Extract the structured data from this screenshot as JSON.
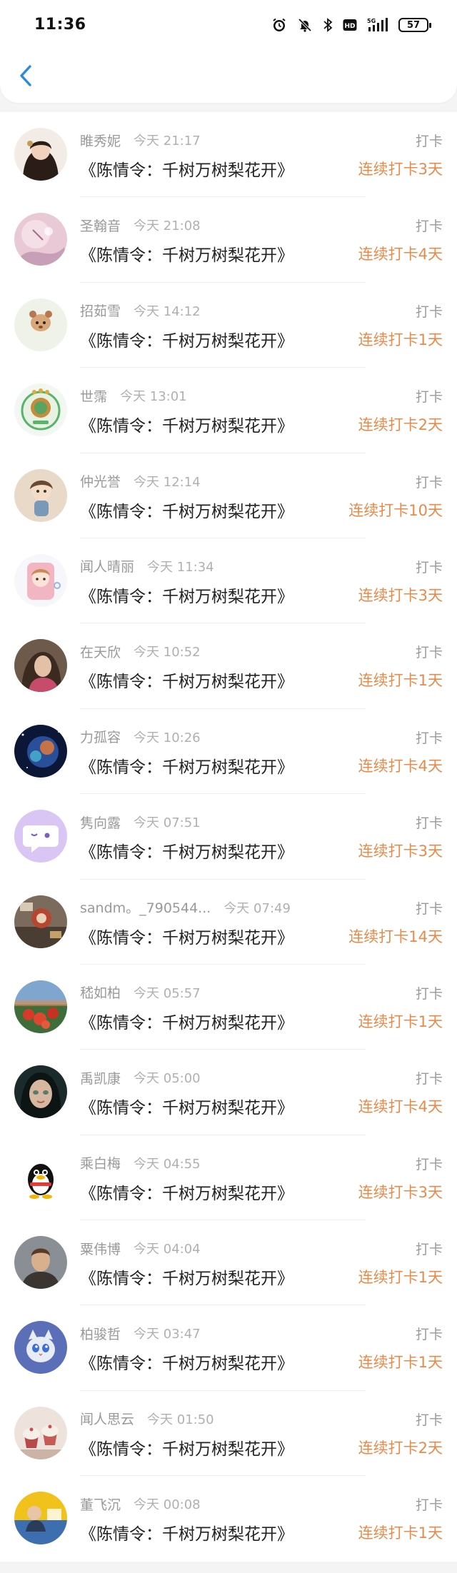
{
  "status_bar": {
    "time": "11:36",
    "battery": "57",
    "icons": [
      "alarm-icon",
      "mute-icon",
      "bluetooth-icon",
      "hd-icon",
      "signal-5g-icon",
      "battery-icon"
    ]
  },
  "header": {
    "back_icon": "chevron-left-icon",
    "accent_color": "#2a8bd8"
  },
  "colors": {
    "streak": "#e88a4a",
    "name": "#999999",
    "book": "#222222"
  },
  "checkins": [
    {
      "name": "睢秀妮",
      "time": "今天 21:17",
      "action": "打卡",
      "book": "《陈情令：千树万树梨花开》",
      "streak": "连续打卡3天",
      "avatar": "avatar-girl-dark-hair"
    },
    {
      "name": "圣翰音",
      "time": "今天 21:08",
      "action": "打卡",
      "book": "《陈情令：千树万树梨花开》",
      "streak": "连续打卡4天",
      "avatar": "avatar-pink-illustration"
    },
    {
      "name": "招茹雪",
      "time": "今天 14:12",
      "action": "打卡",
      "book": "《陈情令：千树万树梨花开》",
      "streak": "连续打卡1天",
      "avatar": "avatar-cartoon-animal"
    },
    {
      "name": "世霈",
      "time": "今天 13:01",
      "action": "打卡",
      "book": "《陈情令：千树万树梨花开》",
      "streak": "连续打卡2天",
      "avatar": "avatar-green-badge"
    },
    {
      "name": "仲光誉",
      "time": "今天 12:14",
      "action": "打卡",
      "book": "《陈情令：千树万树梨花开》",
      "streak": "连续打卡10天",
      "avatar": "avatar-doll"
    },
    {
      "name": "闻人晴丽",
      "time": "今天 11:34",
      "action": "打卡",
      "book": "《陈情令：千树万树梨花开》",
      "streak": "连续打卡3天",
      "avatar": "avatar-cartoon-girl"
    },
    {
      "name": "在天欣",
      "time": "今天 10:52",
      "action": "打卡",
      "book": "《陈情令：千树万树梨花开》",
      "streak": "连续打卡1天",
      "avatar": "avatar-woman-photo"
    },
    {
      "name": "力孤容",
      "time": "今天 10:26",
      "action": "打卡",
      "book": "《陈情令：千树万树梨花开》",
      "streak": "连续打卡4天",
      "avatar": "avatar-planet"
    },
    {
      "name": "隽向露",
      "time": "今天 07:51",
      "action": "打卡",
      "book": "《陈情令：千树万树梨花开》",
      "streak": "连续打卡3天",
      "avatar": "avatar-purple-chat"
    },
    {
      "name": "sandm。_790544...",
      "time": "今天 07:49",
      "action": "打卡",
      "book": "《陈情令：千树万树梨花开》",
      "streak": "连续打卡14天",
      "avatar": "avatar-room-photo"
    },
    {
      "name": "嵇如柏",
      "time": "今天 05:57",
      "action": "打卡",
      "book": "《陈情令：千树万树梨花开》",
      "streak": "连续打卡1天",
      "avatar": "avatar-red-flowers"
    },
    {
      "name": "禹凯康",
      "time": "今天 05:00",
      "action": "打卡",
      "book": "《陈情令：千树万树梨花开》",
      "streak": "连续打卡4天",
      "avatar": "avatar-girl-face"
    },
    {
      "name": "乘白梅",
      "time": "今天 04:55",
      "action": "打卡",
      "book": "《陈情令：千树万树梨花开》",
      "streak": "连续打卡3天",
      "avatar": "avatar-qq-penguin"
    },
    {
      "name": "粟伟博",
      "time": "今天 04:04",
      "action": "打卡",
      "book": "《陈情令：千树万树梨花开》",
      "streak": "连续打卡1天",
      "avatar": "avatar-man-photo"
    },
    {
      "name": "柏骏哲",
      "time": "今天 03:47",
      "action": "打卡",
      "book": "《陈情令：千树万树梨花开》",
      "streak": "连续打卡1天",
      "avatar": "avatar-blue-cat"
    },
    {
      "name": "闻人思云",
      "time": "今天 01:50",
      "action": "打卡",
      "book": "《陈情令：千树万树梨花开》",
      "streak": "连续打卡2天",
      "avatar": "avatar-cupcakes"
    },
    {
      "name": "董飞沉",
      "time": "今天 00:08",
      "action": "打卡",
      "book": "《陈情令：千树万树梨花开》",
      "streak": "连续打卡1天",
      "avatar": "avatar-yellow-photo"
    }
  ]
}
